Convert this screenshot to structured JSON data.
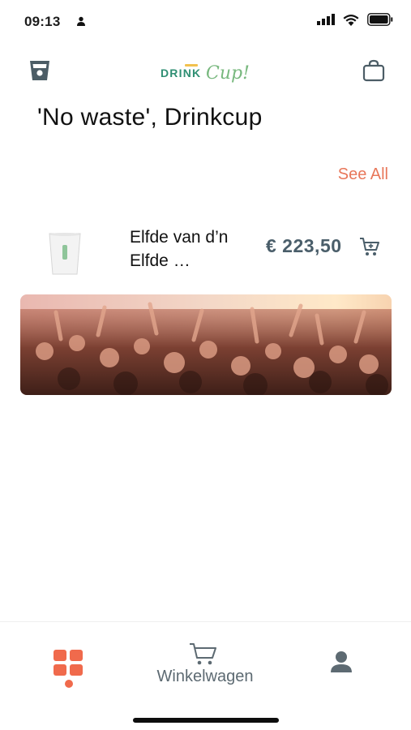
{
  "status": {
    "time": "09:13"
  },
  "header": {
    "logo_left": "DRINK",
    "logo_right": "Cup!"
  },
  "title": "'No waste', Drinkcup",
  "see_all": "See All",
  "product": {
    "name": "Elfde van d’n Elfde …",
    "price": "€ 223,50"
  },
  "bottom_nav": {
    "cart_label": "Winkelwagen"
  },
  "colors": {
    "accent": "#e8775a",
    "nav_active": "#f06a4c",
    "price": "#4a5e6a",
    "icon": "#4c5d66"
  }
}
